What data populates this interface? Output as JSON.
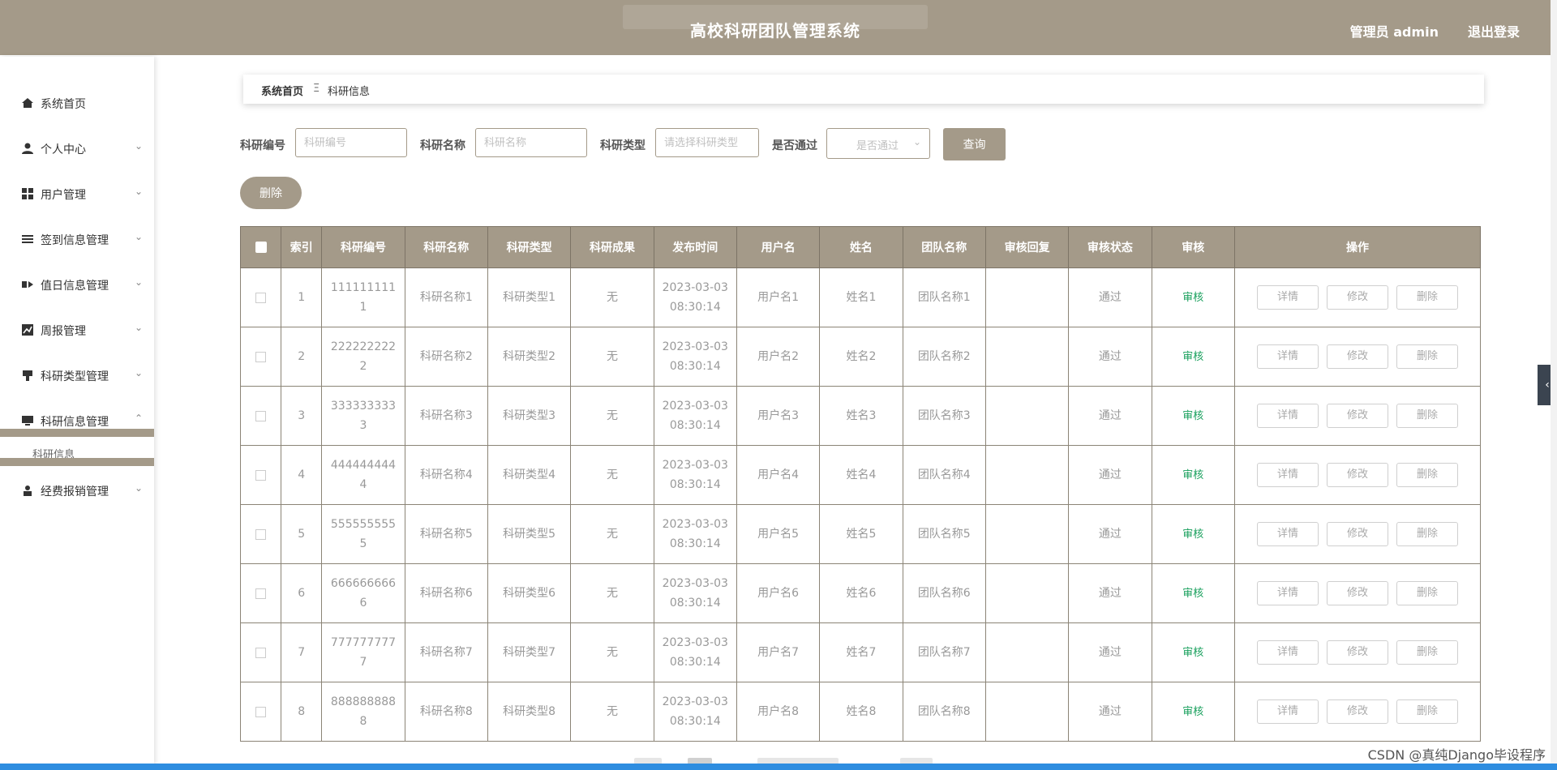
{
  "header": {
    "title": "高校科研团队管理系统",
    "admin_label": "管理员 admin",
    "logout_label": "退出登录"
  },
  "sidebar": {
    "items": [
      {
        "label": "系统首页",
        "icon": "home-icon"
      },
      {
        "label": "个人中心",
        "icon": "user-icon"
      },
      {
        "label": "用户管理",
        "icon": "grid-icon"
      },
      {
        "label": "签到信息管理",
        "icon": "list-icon"
      },
      {
        "label": "值日信息管理",
        "icon": "duty-icon"
      },
      {
        "label": "周报管理",
        "icon": "chart-icon"
      },
      {
        "label": "科研类型管理",
        "icon": "flag-icon"
      },
      {
        "label": "科研信息管理",
        "icon": "monitor-icon"
      },
      {
        "label": "经费报销管理",
        "icon": "person-icon"
      }
    ],
    "active_submenu": "科研信息"
  },
  "breadcrumb": {
    "home": "系统首页",
    "separator": "Ξ",
    "current": "科研信息"
  },
  "search": {
    "code_label": "科研编号",
    "code_placeholder": "科研编号",
    "name_label": "科研名称",
    "name_placeholder": "科研名称",
    "type_label": "科研类型",
    "type_placeholder": "请选择科研类型",
    "pass_label": "是否通过",
    "pass_placeholder": "是否通过",
    "query_button": "查询"
  },
  "batch_delete_label": "删除",
  "table": {
    "headers": [
      "索引",
      "科研编号",
      "科研名称",
      "科研类型",
      "科研成果",
      "发布时间",
      "用户名",
      "姓名",
      "团队名称",
      "审核回复",
      "审核状态",
      "审核",
      "操作"
    ],
    "action_labels": {
      "detail": "详情",
      "edit": "修改",
      "delete": "删除"
    },
    "audit_label": "审核",
    "rows": [
      {
        "index": "1",
        "code": "1111111111",
        "name": "科研名称1",
        "type": "科研类型1",
        "result": "无",
        "date": "2023-03-03",
        "time": "08:30:14",
        "username": "用户名1",
        "realname": "姓名1",
        "team": "团队名称1",
        "reply": "",
        "status": "通过"
      },
      {
        "index": "2",
        "code": "2222222222",
        "name": "科研名称2",
        "type": "科研类型2",
        "result": "无",
        "date": "2023-03-03",
        "time": "08:30:14",
        "username": "用户名2",
        "realname": "姓名2",
        "team": "团队名称2",
        "reply": "",
        "status": "通过"
      },
      {
        "index": "3",
        "code": "3333333333",
        "name": "科研名称3",
        "type": "科研类型3",
        "result": "无",
        "date": "2023-03-03",
        "time": "08:30:14",
        "username": "用户名3",
        "realname": "姓名3",
        "team": "团队名称3",
        "reply": "",
        "status": "通过"
      },
      {
        "index": "4",
        "code": "4444444444",
        "name": "科研名称4",
        "type": "科研类型4",
        "result": "无",
        "date": "2023-03-03",
        "time": "08:30:14",
        "username": "用户名4",
        "realname": "姓名4",
        "team": "团队名称4",
        "reply": "",
        "status": "通过"
      },
      {
        "index": "5",
        "code": "5555555555",
        "name": "科研名称5",
        "type": "科研类型5",
        "result": "无",
        "date": "2023-03-03",
        "time": "08:30:14",
        "username": "用户名5",
        "realname": "姓名5",
        "team": "团队名称5",
        "reply": "",
        "status": "通过"
      },
      {
        "index": "6",
        "code": "6666666666",
        "name": "科研名称6",
        "type": "科研类型6",
        "result": "无",
        "date": "2023-03-03",
        "time": "08:30:14",
        "username": "用户名6",
        "realname": "姓名6",
        "team": "团队名称6",
        "reply": "",
        "status": "通过"
      },
      {
        "index": "7",
        "code": "7777777777",
        "name": "科研名称7",
        "type": "科研类型7",
        "result": "无",
        "date": "2023-03-03",
        "time": "08:30:14",
        "username": "用户名7",
        "realname": "姓名7",
        "team": "团队名称7",
        "reply": "",
        "status": "通过"
      },
      {
        "index": "8",
        "code": "8888888888",
        "name": "科研名称8",
        "type": "科研类型8",
        "result": "无",
        "date": "2023-03-03",
        "time": "08:30:14",
        "username": "用户名8",
        "realname": "姓名8",
        "team": "团队名称8",
        "reply": "",
        "status": "通过"
      }
    ]
  },
  "watermark": "CSDN @真纯Django毕设程序",
  "colors": {
    "accent": "#a49a89",
    "audit_link": "#19a05d",
    "side_tab": "#3b4450",
    "progress": "#2e8de0"
  }
}
